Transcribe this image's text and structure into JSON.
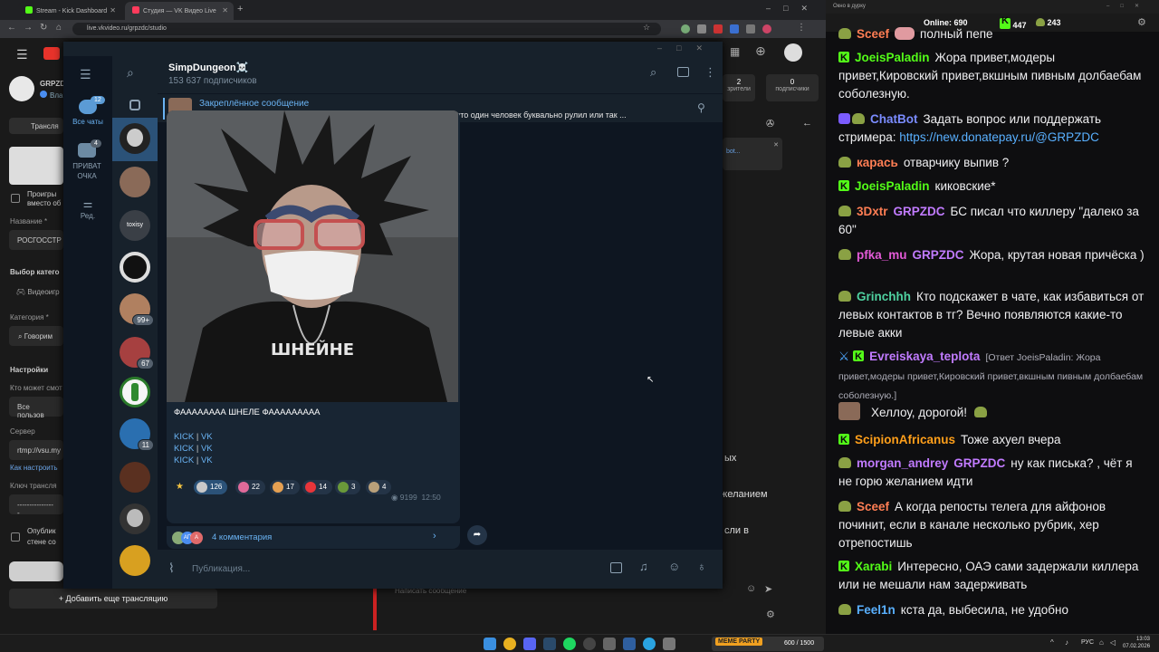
{
  "browser": {
    "tabs": [
      {
        "label": "Stream - Kick Dashboard",
        "color": "#53fc18"
      },
      {
        "label": "Студия — VK Видео Live",
        "color": "#ff3b5c"
      }
    ],
    "url": "live.vkvideo.ru/grpzdc/studio"
  },
  "vk": {
    "channel": "GRPZDC",
    "channel_sub": "Вла",
    "nav_translation": "Трансля",
    "play_label": "Проигры",
    "play_label2": "вместо об",
    "name_label": "Название *",
    "name_value": "РОСГОССТР",
    "category_choice": "Выбор катего",
    "category_games": "Видеоигр",
    "category_label": "Категория *",
    "category_value": "Говорим",
    "settings": "Настройки",
    "who_can": "Кто может смот",
    "who_value": "Все пользов",
    "server_label": "Сервер",
    "server_value": "rtmp://vsu.my",
    "how_setup": "Как настроить",
    "key_label": "Ключ трансля",
    "key_value": "----------------",
    "publish": "Опублик",
    "publish2": "стене со",
    "add_stream": "Добавить еще трансляцию",
    "stat1_val": "2",
    "stat1_lbl": "зрители",
    "stat2_val": "0",
    "stat2_lbl": "подписчики",
    "chat_placeholder": "Написать сообщение",
    "bot_text": "bot...",
    "frag1": "ых",
    "frag2": "желанием",
    "frag3": "сли в"
  },
  "tg": {
    "folders": [
      {
        "label": "Все чаты",
        "badge": "12"
      },
      {
        "label": "ПРИВАТ ОЧКА",
        "badge": "4"
      },
      {
        "label": "Ред.",
        "badge": ""
      }
    ],
    "chat_badges": [
      "99+",
      "67",
      "11"
    ],
    "avatar_text": "toxisy",
    "channel_title": "SimpDungeon☠️",
    "subscribers": "153 637 подписчиков",
    "pinned_title": "Закреплённое сообщение",
    "pinned_text": "В общем, сегодняшний день и сливы Эпштейна говорят нам о том, что один человек буквально рулил или так ...",
    "caption": "ФАААААААА ШНЕЛЕ ФААААААААА",
    "shirt_text": "ШНЕЙНЕ",
    "links": [
      {
        "a": "KICK",
        "b": "VK"
      },
      {
        "a": "KICK",
        "b": "VK"
      },
      {
        "a": "KICK",
        "b": "VK"
      }
    ],
    "reactions": [
      {
        "count": "126",
        "color": "#c9c9c9"
      },
      {
        "count": "22",
        "color": "#e06a9a"
      },
      {
        "count": "17",
        "color": "#e5a052"
      },
      {
        "count": "14",
        "color": "#e8353a"
      },
      {
        "count": "3",
        "color": "#6a9a3a"
      },
      {
        "count": "4",
        "color": "#b9a07a"
      }
    ],
    "views": "9199",
    "time": "12:50",
    "comments": "4 комментария",
    "comment_avatars": [
      "АП",
      "А"
    ],
    "input_placeholder": "Публикация..."
  },
  "chat": {
    "window_title": "Окно в дурку",
    "online_label": "Online:",
    "online": "690",
    "kick_count": "447",
    "other_count": "243",
    "messages": [
      {
        "user": "Sceef",
        "color": "#ff7e54",
        "badge": "pepe",
        "text": "полный пепе"
      },
      {
        "user": "JoeisPaladin",
        "color": "#53fc18",
        "badge": "kick",
        "text": "Жора привет,модеры привет,Кировский привет,вкшным пивным долбаебам соболезную."
      },
      {
        "user": "ChatBot",
        "color": "#7b8cff",
        "badge": "bot",
        "text": "Задать вопрос или поддержать стримера: ",
        "link": "https://new.donatepay.ru/@GRPZDC"
      },
      {
        "user": "карась",
        "color": "#ff7e54",
        "badge": "pepe",
        "text": "отварчику выпив ?"
      },
      {
        "user": "JoeisPaladin",
        "color": "#53fc18",
        "badge": "kick",
        "text": "киковские*"
      },
      {
        "user": "3Dxtr",
        "color": "#ff7e54",
        "badge": "pepe",
        "mention": "GRPZDC",
        "text": "БС писал что киллеру \"далеко за 60\""
      },
      {
        "user": "pfka_mu",
        "color": "#e35ad7",
        "badge": "pepe",
        "mention": "GRPZDC",
        "text": "Жора, крутая новая причёска )"
      },
      {
        "user": "Grinchhh",
        "color": "#4fd1a0",
        "badge": "pepe",
        "text": "Кто подскажет в чате, как избавиться от левых контактов в тг? Вечно появляются какие-то левые акки"
      },
      {
        "user": "Evreiskaya_teplota",
        "color": "#c17bff",
        "badge": "kick2",
        "reply": "[Ответ JoeisPaladin: Жора привет,модеры привет,Кировский привет,вкшным пивным долбаебам соболезную.]",
        "text": ""
      },
      {
        "user": "",
        "color": "#ffffff",
        "badge": "avatar",
        "text": "Хеллоу, дорогой!"
      },
      {
        "user": "ScipionAfricanus",
        "color": "#ff9f1a",
        "badge": "kick",
        "text": "Тоже ахуел вчера"
      },
      {
        "user": "morgan_andrey",
        "color": "#c17bff",
        "badge": "pepe",
        "mention": "GRPZDC",
        "text": "ну как писька? , чёт я не горю желанием идти"
      },
      {
        "user": "Sceef",
        "color": "#ff7e54",
        "badge": "pepe",
        "text": "А когда репосты телега для айфонов починит, если в канале несколько рубрик, хер отрепостишь"
      },
      {
        "user": "Xarabi",
        "color": "#53fc18",
        "badge": "kick",
        "text": "Интересно, ОАЭ сами задержали киллера или не мешали нам задерживать"
      },
      {
        "user": "Feel1n",
        "color": "#59b0ff",
        "badge": "pepe",
        "text": "кста да, выбесила, не удобно"
      }
    ]
  },
  "taskbar": {
    "meme_label": "MEME PARTY",
    "meme_counter": "600 / 1500",
    "lang": "РУС",
    "time": "13:03",
    "date": "07.02.2026"
  }
}
